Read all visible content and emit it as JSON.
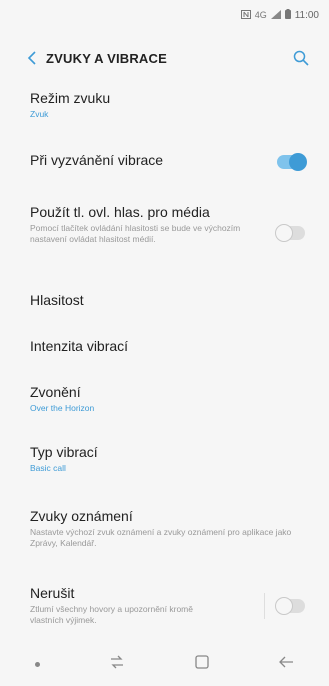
{
  "status_bar": {
    "icons": [
      "nfc-icon",
      "data-icon",
      "signal-icon",
      "battery-icon"
    ],
    "data_label": "4G",
    "time": "11:00"
  },
  "header": {
    "back_icon": "chevron-left-icon",
    "title": "ZVUKY A VIBRACE",
    "search_icon": "search-icon"
  },
  "items": [
    {
      "label": "Režim zvuku",
      "sub": "Zvuk"
    },
    {
      "label": "Při vyzvánění vibrace",
      "toggle": "on"
    },
    {
      "label": "Použít tl. ovl. hlas. pro média",
      "sub": "Pomocí tlačítek ovládání hlasitosti se bude ve výchozím nastavení ovládat hlasitost médií.",
      "toggle": "off"
    },
    {
      "label": "Hlasitost"
    },
    {
      "label": "Intenzita vibrací"
    },
    {
      "label": "Zvonění",
      "sub": "Over the Horizon"
    },
    {
      "label": "Typ vibrací",
      "sub": "Basic call"
    },
    {
      "label": "Zvuky oznámení",
      "sub": "Nastavte výchozí zvuk oznámení a zvuky oznámení pro aplikace jako Zprávy, Kalendář."
    },
    {
      "label": "Nerušit",
      "sub": "Ztlumí všechny hovory a upozornění kromě vlastních výjimek.",
      "toggle": "off"
    }
  ],
  "navbar": {
    "icons": [
      "dot-icon",
      "recents-icon",
      "home-icon",
      "back-arrow-icon"
    ]
  },
  "colors": {
    "accent": "#3e9bd6",
    "accent_track": "#7fc3ec",
    "background": "#f6f6f6"
  }
}
